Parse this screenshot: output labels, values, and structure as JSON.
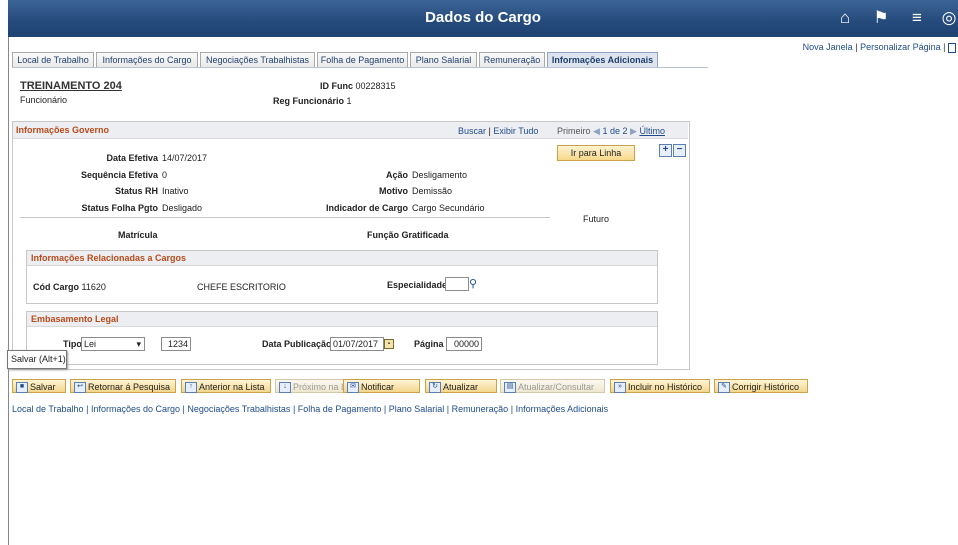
{
  "header": {
    "title": "Dados do Cargo"
  },
  "top_links": {
    "new_window": "Nova Janela",
    "personalize": "Personalizar Página",
    "sep": "|"
  },
  "tabs": [
    {
      "label": "Local de Trabalho"
    },
    {
      "label": "Informações do Cargo"
    },
    {
      "label": "Negociações Trabalhistas"
    },
    {
      "label": "Folha de Pagamento"
    },
    {
      "label": "Plano Salarial"
    },
    {
      "label": "Remuneração"
    },
    {
      "label": "Informações Adicionais"
    }
  ],
  "employee": {
    "name": "TREINAMENTO 204",
    "role": "Funcionário",
    "id_label": "ID Func",
    "id_value": "00228315",
    "reg_label": "Reg Funcionário",
    "reg_value": "1"
  },
  "gov": {
    "title": "Informações Governo",
    "search": "Buscar",
    "show_all": "Exibir Tudo",
    "first": "Primeiro",
    "pager": "1 de 2",
    "last": "Último",
    "go_line": "Ir para Linha",
    "add": "+",
    "remove": "−",
    "date_label": "Data Efetiva",
    "date_value": "14/07/2017",
    "seq_label": "Sequência Efetiva",
    "seq_value": "0",
    "status_label": "Status RH",
    "status_value": "Inativo",
    "payroll_label": "Status Folha Pgto",
    "payroll_value": "Desligado",
    "action_label": "Ação",
    "action_value": "Desligamento",
    "reason_label": "Motivo",
    "reason_value": "Demissão",
    "ind_label": "Indicador de Cargo",
    "ind_value": "Cargo Secundário",
    "future": "Futuro",
    "matricula": "Matrícula",
    "funcao": "Função Gratificada"
  },
  "related": {
    "title": "Informações Relacionadas a Cargos",
    "code_label": "Cód Cargo",
    "code_value": "11620",
    "code_desc": "CHEFE ESCRITORIO",
    "spec_label": "Especialidade",
    "spec_value": ""
  },
  "legal": {
    "title": "Embasamento Legal",
    "type_label": "Tipo",
    "type_value": "Lei",
    "number_value": "1234",
    "pub_label": "Data Publicação",
    "pub_value": "01/07/2017",
    "page_label": "Página",
    "page_value": "00000"
  },
  "tooltip": "Salvar (Alt+1)",
  "toolbar": {
    "save": "Salvar",
    "back": "Retornar á Pesquisa",
    "prev": "Anterior na Lista",
    "next": "Próximo na Lista",
    "notify": "Notificar",
    "refresh": "Atualizar",
    "update_view": "Atualizar/Consultar",
    "include_hist": "Incluir no Histórico",
    "correct_hist": "Corrigir Histórico"
  },
  "bottom_links": {
    "items": [
      "Local de Trabalho",
      "Informações do Cargo",
      "Negociações Trabalhistas",
      "Folha de Pagamento",
      "Plano Salarial",
      "Remuneração",
      "Informações Adicionais"
    ],
    "sep": "|"
  }
}
